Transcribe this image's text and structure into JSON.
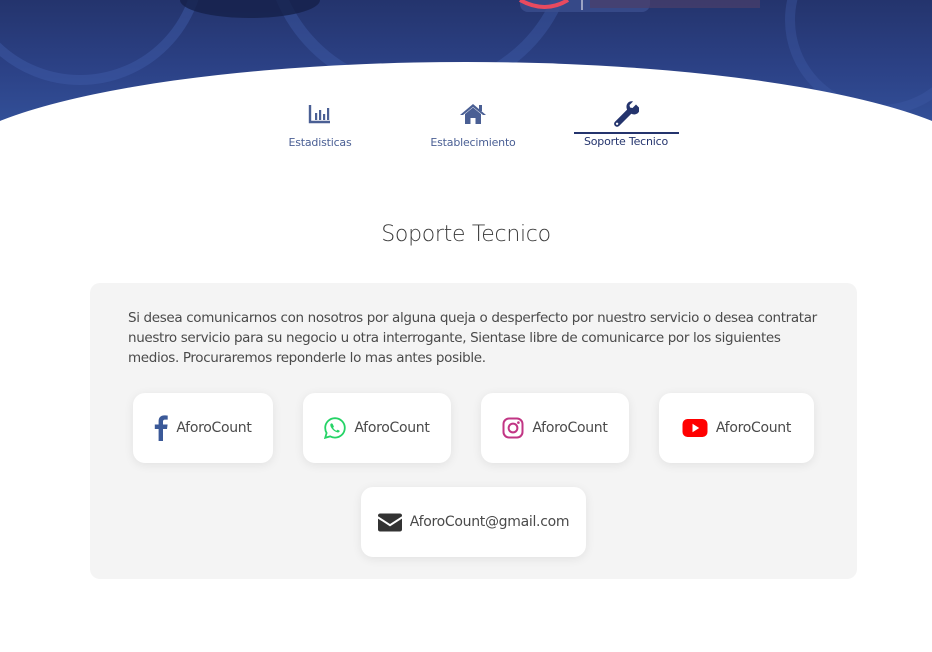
{
  "tabs": [
    {
      "label": "Estadisticas",
      "icon": "chart-bar-icon"
    },
    {
      "label": "Establecimiento",
      "icon": "home-icon"
    },
    {
      "label": "Soporte Tecnico",
      "icon": "wrench-icon",
      "active": true
    }
  ],
  "section": {
    "title": "Soporte Tecnico",
    "description": "Si desea comunicarnos con nosotros por alguna queja o desperfecto por nuestro servicio o desea contratar nuestro servicio para su negocio u otra interrogante, Sientase libre de comunicarce por los siguientes medios. Procuraremos reponderle lo mas antes posible."
  },
  "contacts": [
    {
      "label": "AforoCount",
      "icon": "facebook-icon",
      "color": "#3b5998"
    },
    {
      "label": "AforoCount",
      "icon": "whatsapp-icon",
      "color": "#25d366"
    },
    {
      "label": "AforoCount",
      "icon": "instagram-icon",
      "color": "#c13584"
    },
    {
      "label": "AforoCount",
      "icon": "youtube-icon",
      "color": "#ff0000"
    },
    {
      "label": "AforoCount@gmail.com",
      "icon": "envelope-icon",
      "color": "#333333"
    }
  ],
  "colors": {
    "brand_dark": "#24346d",
    "brand": "#33519a",
    "card_bg": "#f4f4f4"
  }
}
